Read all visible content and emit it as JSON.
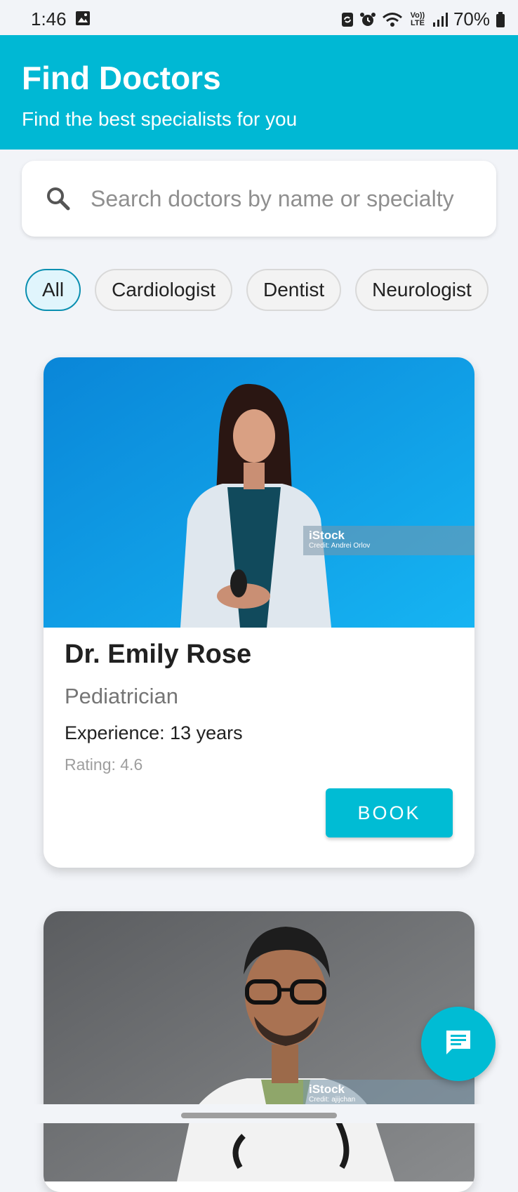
{
  "status_bar": {
    "time": "1:46",
    "battery_percent": "70%",
    "icons": [
      "gallery-icon",
      "sync-icon",
      "alarm-icon",
      "wifi-icon",
      "volte-icon",
      "signal-icon",
      "battery-icon"
    ],
    "volte_label": "Vo)) LTE"
  },
  "header": {
    "title": "Find Doctors",
    "subtitle": "Find the best specialists for you",
    "color": "#00b8d4"
  },
  "search": {
    "placeholder": "Search doctors by name or specialty",
    "value": ""
  },
  "filters": {
    "selected": "All",
    "chips": [
      "All",
      "Cardiologist",
      "Dentist",
      "Neurologist"
    ]
  },
  "doctors": [
    {
      "name": "Dr. Emily Rose",
      "specialty": "Pediatrician",
      "experience": "Experience: 13 years",
      "rating": "Rating: 4.6",
      "book_label": "BOOK",
      "watermark_brand": "iStock",
      "watermark_credit": "Credit: Andrei Orlov"
    },
    {
      "watermark_brand": "iStock",
      "watermark_credit": "Credit: ajijchan"
    }
  ],
  "fab": {
    "icon": "chat-icon"
  },
  "colors": {
    "accent": "#00bcd4",
    "background": "#f2f4f8"
  }
}
